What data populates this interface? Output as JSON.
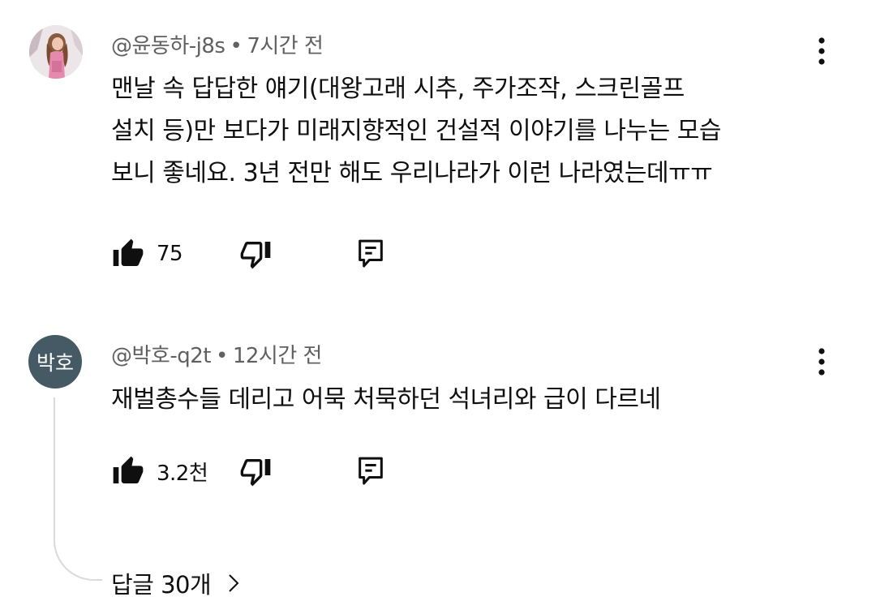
{
  "comments": [
    {
      "author": "@윤동하-j8s",
      "separator": "•",
      "time": "7시간 전",
      "text_lines": [
        "맨날 속 답답한 얘기(대왕고래 시추, 주가조작, 스크린골프",
        "설치 등)만 보다가 미래지향적인 건설적 이야기를 나누는 모습",
        "보니 좋네요. 3년 전만 해도 우리나라가 이런 나라였는데ㅠㅠ"
      ],
      "likes": "75",
      "icons": {
        "like": "thumbs-up-filled-icon",
        "dislike": "thumbs-down-outline-icon",
        "reply": "reply-comment-icon",
        "more": "more-vertical-icon"
      }
    },
    {
      "author": "@박호-q2t",
      "separator": "•",
      "time": "12시간 전",
      "avatar_initials": "박호",
      "avatar_color": "#455a64",
      "text_lines": [
        "재벌총수들 데리고 어묵 처묵하던 석녀리와 급이 다르네"
      ],
      "likes": "3.2천",
      "replies_label": "답글 30개"
    }
  ]
}
